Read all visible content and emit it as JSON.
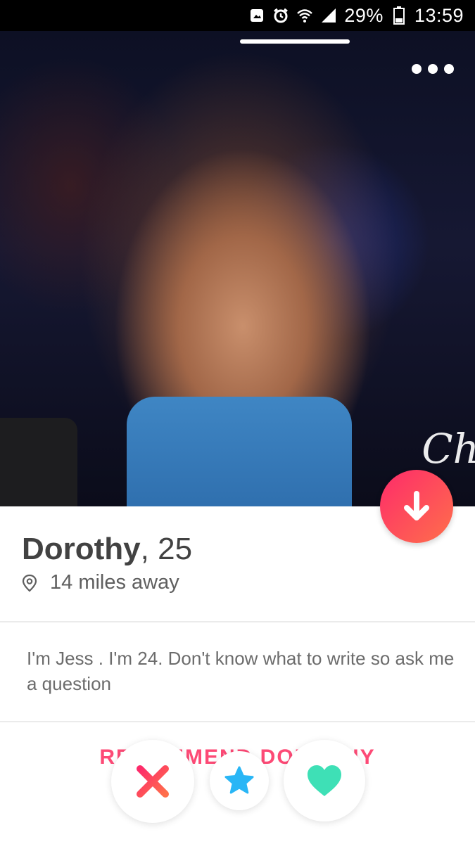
{
  "status_bar": {
    "battery": "29%",
    "time": "13:59",
    "icons": [
      "image-notification-icon",
      "alarm-icon",
      "wifi-icon",
      "signal-icon",
      "battery-icon"
    ]
  },
  "photo": {
    "watermark": "Ch",
    "photo_index": 1
  },
  "profile": {
    "name": "Dorothy",
    "age": ", 25",
    "distance": "14 miles away",
    "bio": "I'm Jess . I'm 24. Don't know what to write so ask me a question"
  },
  "recommend": {
    "label": "RECOMMEND DOROTHY"
  },
  "actions": {
    "icons": [
      "close-icon",
      "star-icon",
      "heart-icon"
    ]
  },
  "colors": {
    "accent_gradient_start": "#fd2b6a",
    "accent_gradient_end": "#ff6f4b",
    "nope": "#fd3b5c",
    "superlike": "#29b6f6",
    "like": "#3ee0b6"
  }
}
